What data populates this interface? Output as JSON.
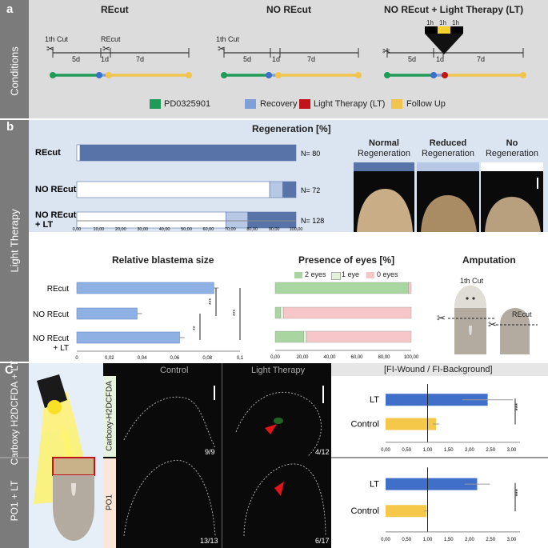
{
  "panel_a": {
    "label": "a",
    "side": "Conditions",
    "col1_title": "REcut",
    "col2_title": "NO REcut",
    "col3_title": "NO REcut + Light Therapy (LT)",
    "cut1": "1th Cut",
    "recut": "REcut",
    "d5": "5d",
    "d1": "1d",
    "d7": "7d",
    "h1": "1h",
    "legend": [
      {
        "label": "PD0325901",
        "color": "#1f9b57"
      },
      {
        "label": "Recovery",
        "color": "#7f9fd6"
      },
      {
        "label": "Light Therapy (LT)",
        "color": "#c0141a"
      },
      {
        "label": "Follow Up",
        "color": "#f0c44d"
      }
    ]
  },
  "panel_b": {
    "label": "b",
    "side": "Light Therapy",
    "regen_title": "Regeneration [%]",
    "regen_legend": [
      "Normal Regeneration",
      "Reduced Regeneration",
      "No Regeneration"
    ],
    "photo_titles": [
      {
        "bold": "Normal",
        "sub": "Regeneration"
      },
      {
        "bold": "Reduced",
        "sub": "Regeneration"
      },
      {
        "bold": "No",
        "sub": "Regeneration"
      }
    ],
    "blastema_title": "Relative blastema size",
    "eyes_title": "Presence of eyes [%]",
    "eyes_legend": [
      "2 eyes",
      "1 eye",
      "0 eyes"
    ],
    "amputation_title": "Amputation",
    "amp_cut1": "1th Cut",
    "amp_recut": "REcut"
  },
  "panel_c": {
    "label": "C",
    "side1": "Carboxy H2DCFDA + LT",
    "side2": "PO1 + LT",
    "col_control": "Control",
    "col_lt": "Light Therapy",
    "row1_label": "Carboxy-H2DCFDA",
    "row2_label": "PO1",
    "counts": [
      "9/9",
      "4/12",
      "13/13",
      "6/17"
    ],
    "ratio_title": "[FI-Wound  /  FI-Background]"
  },
  "chart_data": [
    {
      "type": "bar",
      "orientation": "horizontal-stacked",
      "title": "Regeneration [%]",
      "categories": [
        "REcut",
        "NO REcut",
        "NO REcut + LT"
      ],
      "n_labels": [
        "N= 80",
        "N= 72",
        "N= 128"
      ],
      "series": [
        {
          "name": "Normal Regeneration",
          "values": [
            1.5,
            88,
            68
          ],
          "color": "#ffffff"
        },
        {
          "name": "Reduced Regeneration",
          "values": [
            0,
            6,
            10
          ],
          "color": "#b7c8e6"
        },
        {
          "name": "No Regeneration",
          "values": [
            98.5,
            6,
            22
          ],
          "color": "#5873a8"
        }
      ],
      "xlim": [
        0,
        100
      ],
      "xticks": [
        "0,00",
        "10,00",
        "20,00",
        "30,00",
        "40,00",
        "50,00",
        "60,00",
        "70,00",
        "80,00",
        "90,00",
        "100,00"
      ]
    },
    {
      "type": "bar",
      "orientation": "horizontal",
      "title": "Relative blastema size",
      "categories": [
        "REcut",
        "NO REcut",
        "NO REcut + LT"
      ],
      "values": [
        0.084,
        0.037,
        0.063
      ],
      "errors": [
        0.003,
        0.003,
        0.003
      ],
      "xlim": [
        0,
        0.1
      ],
      "xticks": [
        "0",
        "0,02",
        "0,04",
        "0,06",
        "0,08",
        "0,1"
      ],
      "significance": [
        "***",
        "***",
        "**"
      ]
    },
    {
      "type": "bar",
      "orientation": "horizontal-stacked",
      "title": "Presence of eyes [%]",
      "categories": [
        "REcut",
        "NO REcut",
        "NO REcut + LT"
      ],
      "series": [
        {
          "name": "2 eyes",
          "values": [
            98,
            4,
            21
          ],
          "color": "#a8d5a0"
        },
        {
          "name": "1 eye",
          "values": [
            0,
            2,
            2
          ],
          "color": "#e4f2dc"
        },
        {
          "name": "0 eyes",
          "values": [
            2,
            94,
            77
          ],
          "color": "#f6c6c8"
        }
      ],
      "xlim": [
        0,
        100
      ],
      "xticks": [
        "0,00",
        "20,00",
        "40,00",
        "60,00",
        "80,00",
        "100,00"
      ]
    },
    {
      "type": "bar",
      "orientation": "horizontal",
      "title": "Carboxy-H2DCFDA [FI-Wound / FI-Background]",
      "categories": [
        "LT",
        "Control"
      ],
      "values": [
        2.43,
        1.2
      ],
      "errors": [
        0.6,
        0.08
      ],
      "colors": [
        "#3f6fc8",
        "#f5c84a"
      ],
      "xlim": [
        0,
        3.2
      ],
      "xticks": [
        "0,00",
        "0,50",
        "1,00",
        "1,50",
        "2,00",
        "2,50",
        "3,00"
      ],
      "significance": "***"
    },
    {
      "type": "bar",
      "orientation": "horizontal",
      "title": "PO1 [FI-Wound / FI-Background]",
      "categories": [
        "LT",
        "Control"
      ],
      "values": [
        2.18,
        0.97
      ],
      "errors": [
        0.3,
        0.05
      ],
      "colors": [
        "#3f6fc8",
        "#f5c84a"
      ],
      "xlim": [
        0,
        3.2
      ],
      "xticks": [
        "0,00",
        "0,50",
        "1,00",
        "1,50",
        "2,00",
        "2,50",
        "3,00"
      ],
      "significance": "***"
    }
  ]
}
